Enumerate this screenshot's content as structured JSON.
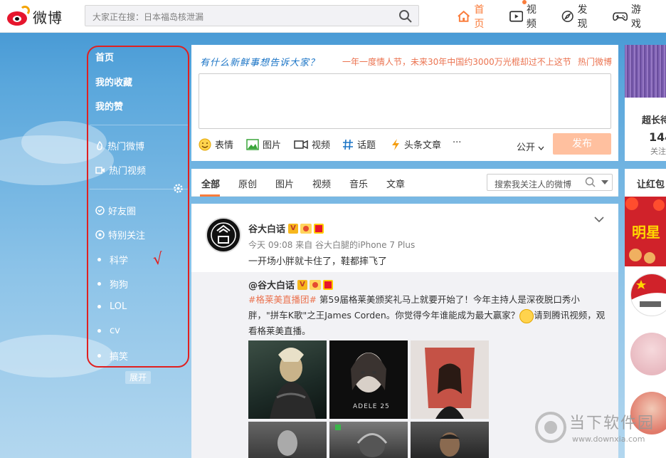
{
  "app": {
    "logo_text": "微博"
  },
  "search": {
    "text": "大家正在搜：日本福岛核泄漏"
  },
  "nav": [
    {
      "label": "首页",
      "icon": "home-icon",
      "active": true
    },
    {
      "label": "视频",
      "icon": "video-icon"
    },
    {
      "label": "发现",
      "icon": "compass-icon"
    },
    {
      "label": "游戏",
      "icon": "gamepad-icon"
    }
  ],
  "left_nav": {
    "main": [
      "首页",
      "我的收藏",
      "我的赞"
    ],
    "hot": [
      "热门微博",
      "热门视频"
    ],
    "groups": [
      "好友圈",
      "特别关注"
    ],
    "tags": [
      "科学",
      "狗狗",
      "LOL",
      "cv",
      "搞笑"
    ],
    "expand": "展开",
    "check_mark": "√"
  },
  "composer": {
    "slogan": "有什么新鲜事想告诉大家？",
    "hot_text": "一年一度情人节，未来30年中国约3000万光棍却过不上这节",
    "hot_tag": "热门微博",
    "tools": [
      "表情",
      "图片",
      "视频",
      "话题",
      "头条文章",
      "···"
    ],
    "visibility": "公开",
    "publish": "发布"
  },
  "feed_tabs": {
    "tabs": [
      "全部",
      "原创",
      "图片",
      "视频",
      "音乐",
      "文章"
    ],
    "search_placeholder": "搜索我关注人的微博"
  },
  "post": {
    "author": "谷大白话",
    "meta": "今天 09:08 来自 谷大白腿的iPhone 7 Plus",
    "text": "一开场小胖就卡住了，鞋都摔飞了",
    "repost": {
      "author": "@谷大白话",
      "topic": "#格莱美直播团#",
      "text_part1": " 第59届格莱美颁奖礼马上就要开始了！今年主持人是深夜脱口秀小胖，\"拼车K歌\"之王James Corden。你觉得今年谁能成为最大赢家？",
      "text_part2": "请到腾讯视频，观看格莱美直播。",
      "thumb2_caption": "ADELE 25"
    }
  },
  "right": {
    "card1_title": "超长待",
    "card1_num": "144",
    "card1_label": "关注",
    "card2_title": "让红包",
    "banner_text": "明星"
  },
  "watermark": {
    "text": "当下软件园",
    "url": "www.downxia.com"
  },
  "colors": {
    "accent": "#fa7d3c",
    "annotation_red": "#e02020",
    "publish_disabled": "#ffc09f",
    "topic": "#eb7350"
  }
}
